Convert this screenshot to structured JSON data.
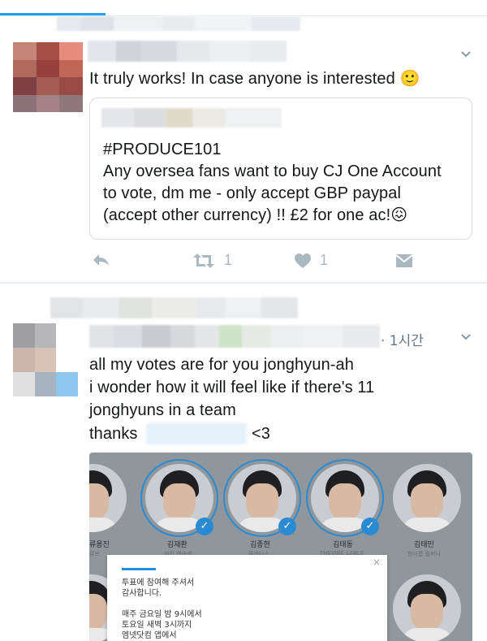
{
  "tweet1": {
    "text": "It truly works! In case anyone is interested 🙂",
    "quoted": {
      "lines": [
        "#PRODUCE101",
        "Any oversea fans want to buy CJ One Account",
        "to vote, dm me - only accept GBP paypal",
        "(accept other currency) !! £2 for one ac!😖"
      ]
    },
    "actions": {
      "reply_icon": "reply-icon",
      "retweet_icon": "retweet-icon",
      "retweet_count": "1",
      "like_icon": "heart-icon",
      "like_count": "1",
      "dm_icon": "envelope-icon"
    }
  },
  "tweet2": {
    "timestamp": "· 1시간",
    "lines": [
      "all my votes are for you jonghyun-ah",
      "i wonder how it will feel like if there's 11",
      "jonghyuns in a team"
    ],
    "thanks_prefix": "thanks",
    "thanks_suffix": "<3",
    "photo": {
      "members": [
        {
          "name": "류용진",
          "agency": "큐브"
        },
        {
          "name": "김재환",
          "agency": "개인 연습생"
        },
        {
          "name": "김종현",
          "agency": "플레디스"
        },
        {
          "name": "김태동",
          "agency": "THEVIBE LABLE"
        },
        {
          "name": "김태민",
          "agency": "한아름 컴퍼니"
        }
      ],
      "dialog": {
        "close": "×",
        "line1": "투표에 참여해 주셔서",
        "line2": "감사합니다.",
        "line3": "매주 금요일 밤 9시에서",
        "line4": "토요일 새벽 3시까지",
        "line5": "엠넷닷컴 앱에서"
      }
    }
  },
  "colors": {
    "accent": "#1da1f2",
    "icon_gray": "#aab8c2",
    "text": "#14171a",
    "check_blue": "#2a8bd2"
  }
}
